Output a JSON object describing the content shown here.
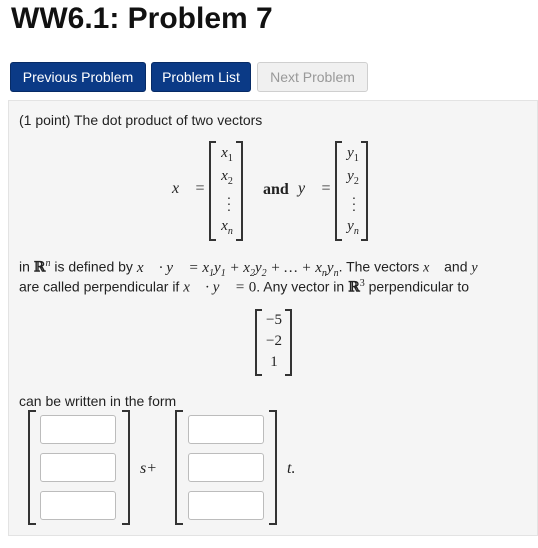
{
  "title": "WW6.1: Problem 7",
  "nav": {
    "previous_label": "Previous Problem",
    "list_label": "Problem List",
    "next_label": "Next Problem"
  },
  "problem": {
    "intro": "(1 point) The dot product of two vectors",
    "x_entries": [
      "x1",
      "x2",
      "⋮",
      "xn"
    ],
    "y_entries": [
      "y1",
      "y2",
      "⋮",
      "yn"
    ],
    "and_word": "and",
    "definition_prefix": "in",
    "definition_middle": "is defined by",
    "definition_formula": "x⃗ · y⃗ = x1y1 + x2y2 + … + xnyn",
    "definition_suffix": ". The vectors",
    "and_word2": "and",
    "line2_prefix": "are called perpendicular if",
    "perp_condition": "x⃗ · y⃗ = 0",
    "line2_middle": ". Any vector in",
    "line2_suffix": "perpendicular to",
    "given_vector": [
      "-5",
      "-2",
      "1"
    ],
    "form_text": "can be written in the form",
    "s_label": "s+",
    "t_label": "t."
  }
}
